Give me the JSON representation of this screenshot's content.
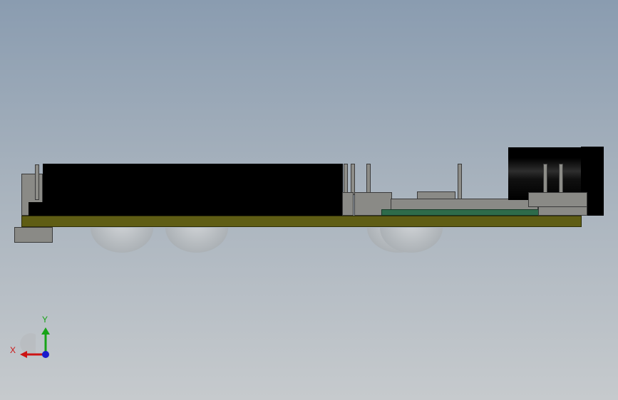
{
  "triad": {
    "x_label": "X",
    "y_label": "Y",
    "colors": {
      "x_axis": "#cc1414",
      "y_axis": "#17a317",
      "z_axis": "#1a1acc"
    }
  },
  "colors": {
    "background_top": "#8a9cb0",
    "background_bottom": "#c6cacd",
    "pcb": "#5f5d14",
    "component_dark": "#000000",
    "component_grey": "#8a8a86",
    "board_green": "#2e6b4b"
  }
}
